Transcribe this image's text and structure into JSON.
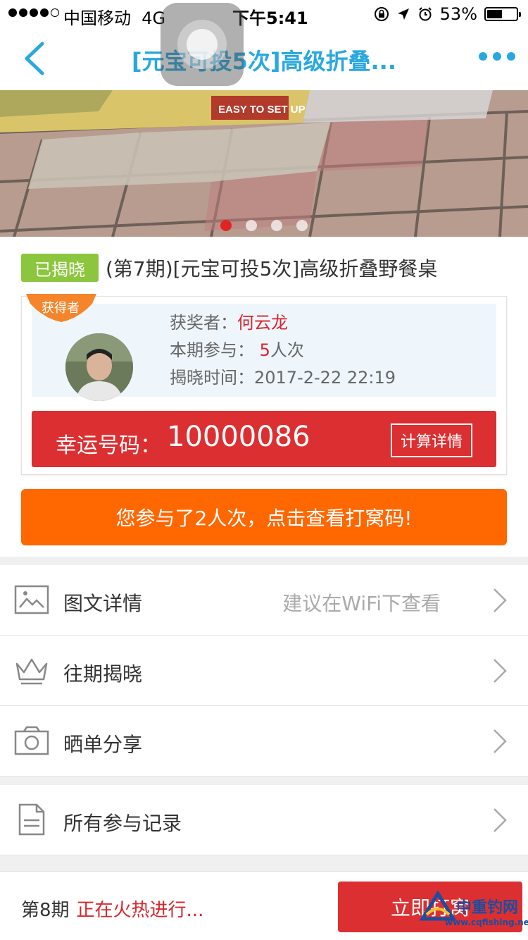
{
  "status_bar": {
    "carrier": "中国移动",
    "network": "4G",
    "time": "下午5:41",
    "battery": "53%",
    "battery_level": 0.53
  },
  "nav": {
    "title": "[元宝可投5次]高级折叠..."
  },
  "banner": {
    "image_text": "EASY TO SET UP",
    "slide_count": 4,
    "active_slide": 0
  },
  "product": {
    "status_badge": "已揭晓",
    "title": "(第7期)[元宝可投5次]高级折叠野餐桌"
  },
  "winner": {
    "ribbon": "获得者",
    "winner_label": "获奖者：",
    "winner_name": "何云龙",
    "participation_label": "本期参与：",
    "participation_count": "5",
    "participation_unit": "人次",
    "reveal_label": "揭晓时间：",
    "reveal_time": "2017-2-22 22:19",
    "lucky_label": "幸运号码：",
    "lucky_number": "10000086",
    "calc_button": "计算详情"
  },
  "my_participation": {
    "button": "您参与了2人次，点击查看打窝码!"
  },
  "menu_group_1": {
    "items": [
      {
        "label": "图文详情",
        "hint": "建议在WiFi下查看",
        "icon": "image-icon"
      },
      {
        "label": "往期揭晓",
        "hint": "",
        "icon": "crown-icon"
      },
      {
        "label": "晒单分享",
        "hint": "",
        "icon": "camera-icon"
      }
    ]
  },
  "menu_group_2": {
    "items": [
      {
        "label": "所有参与记录",
        "hint": "",
        "icon": "document-icon"
      }
    ]
  },
  "bottom_bar": {
    "period": "第8期",
    "status": "正在火热进行...",
    "join_button": "立即打窝"
  },
  "watermark": {
    "text": "中重钓网",
    "url": "www.cqfishing.net"
  },
  "colors": {
    "accent_blue": "#29a8e0",
    "red": "#dc2f31",
    "orange": "#ff6700",
    "green_badge": "#8cc63f"
  }
}
